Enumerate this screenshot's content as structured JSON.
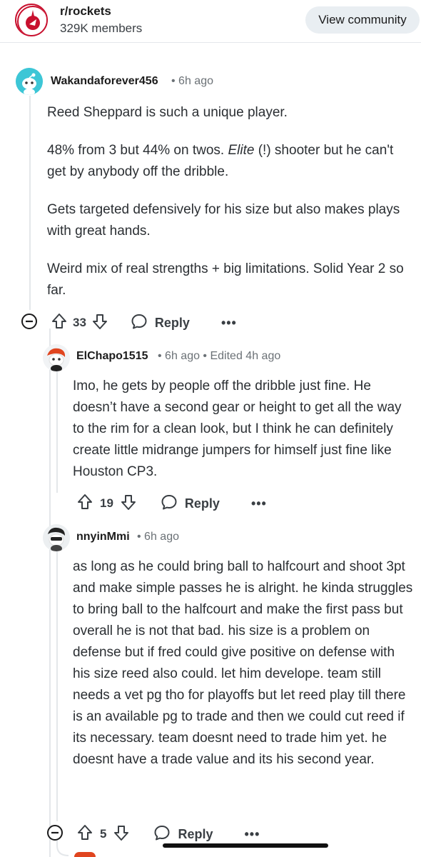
{
  "community": {
    "name": "r/rockets",
    "members": "329K members",
    "view_button": "View community",
    "logo_text_top": "HOUSTON",
    "logo_text_bottom": "ROCKETS"
  },
  "comments": [
    {
      "author": "Wakandaforever456",
      "time": "6h ago",
      "edited": "",
      "paragraphs": [
        "Reed Sheppard is such a unique player.",
        "48% from 3 but 44% on twos.",
        "Gets targeted defensively for his size but also makes plays with great hands.",
        "Weird mix of real strengths + big limitations. Solid Year 2 so far."
      ],
      "p2_italic": "Elite",
      "p2_rest": "(!) shooter but he can't get by anybody off the dribble.",
      "score": "33",
      "reply_label": "Reply",
      "more": "•••"
    },
    {
      "author": "ElChapo1515",
      "time": "6h ago",
      "edited": "Edited 4h ago",
      "paragraphs": [
        "Imo, he gets by people off the dribble just fine. He doesn’t have a second gear or height to get all the way to the rim for a clean look, but I think he can definitely create little midrange jumpers for himself just fine like Houston CP3."
      ],
      "score": "19",
      "reply_label": "Reply",
      "more": "•••"
    },
    {
      "author": "nnyinMmi",
      "time": "6h ago",
      "edited": "",
      "paragraphs": [
        "as long as he could bring ball to halfcourt and shoot 3pt and make simple passes he is alright. he kinda struggles to bring ball to the halfcourt and make the first pass but overall he is not that bad. his size is a problem on defense but if fred could give positive on defense with his size reed also could. let him develope. team still needs a vet pg tho for playoffs but let reed play till there is an available pg to trade and then we could cut reed if its necessary. team doesnt need to trade him yet. he doesnt have a trade value and its his second year."
      ],
      "score": "5",
      "reply_label": "Reply",
      "more": "•••"
    }
  ],
  "colors": {
    "accent_red": "#c8102e",
    "muted": "#6b7176",
    "thread_line": "#e4e7ea",
    "button_bg": "#e9eef2"
  }
}
